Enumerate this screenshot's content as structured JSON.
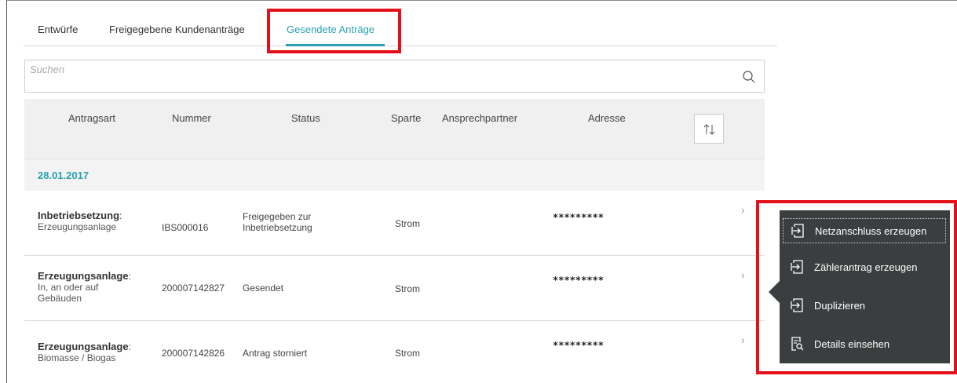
{
  "tabs": [
    {
      "label": "Entwürfe"
    },
    {
      "label": "Freigegebene Kundenanträge"
    },
    {
      "label": "Gesendete Anträge",
      "active": true
    }
  ],
  "search": {
    "placeholder": "Suchen"
  },
  "table": {
    "columns": [
      "Antragsart",
      "Nummer",
      "Status",
      "Sparte",
      "Ansprechpartner",
      "Adresse"
    ],
    "groups": [
      {
        "date": "28.01.2017",
        "rows": [
          {
            "type_title": "Inbetriebsetzung",
            "type_sub_1": "Erzeugungsanlage",
            "type_sub_2": "",
            "number": "IBS000016",
            "status_1": "Freigegeben zur",
            "status_2": "Inbetriebsetzung",
            "sparte": "Strom",
            "contact": "",
            "address": "*********"
          },
          {
            "type_title": "Erzeugungsanlage",
            "type_sub_1": "In, an oder auf",
            "type_sub_2": "Gebäuden",
            "number": "200007142827",
            "status_1": "Gesendet",
            "status_2": "",
            "sparte": "Strom",
            "contact": "",
            "address": "*********"
          },
          {
            "type_title": "Erzeugungsanlage",
            "type_sub_1": "Biomasse / Biogas",
            "type_sub_2": "",
            "number": "200007142826",
            "status_1": "Antrag storniert",
            "status_2": "",
            "sparte": "Strom",
            "contact": "",
            "address": "*********"
          }
        ]
      }
    ]
  },
  "menu": {
    "items": [
      {
        "label": "Netzanschluss erzeugen",
        "icon": "export-icon"
      },
      {
        "label": "Zählerantrag erzeugen",
        "icon": "export-icon"
      },
      {
        "label": "Duplizieren",
        "icon": "export-icon"
      },
      {
        "label": "Details einsehen",
        "icon": "document-search-icon"
      }
    ]
  },
  "colors": {
    "accent": "#2a9fb0",
    "highlight": "#e3101a",
    "menu_bg": "#3a3e3f"
  }
}
